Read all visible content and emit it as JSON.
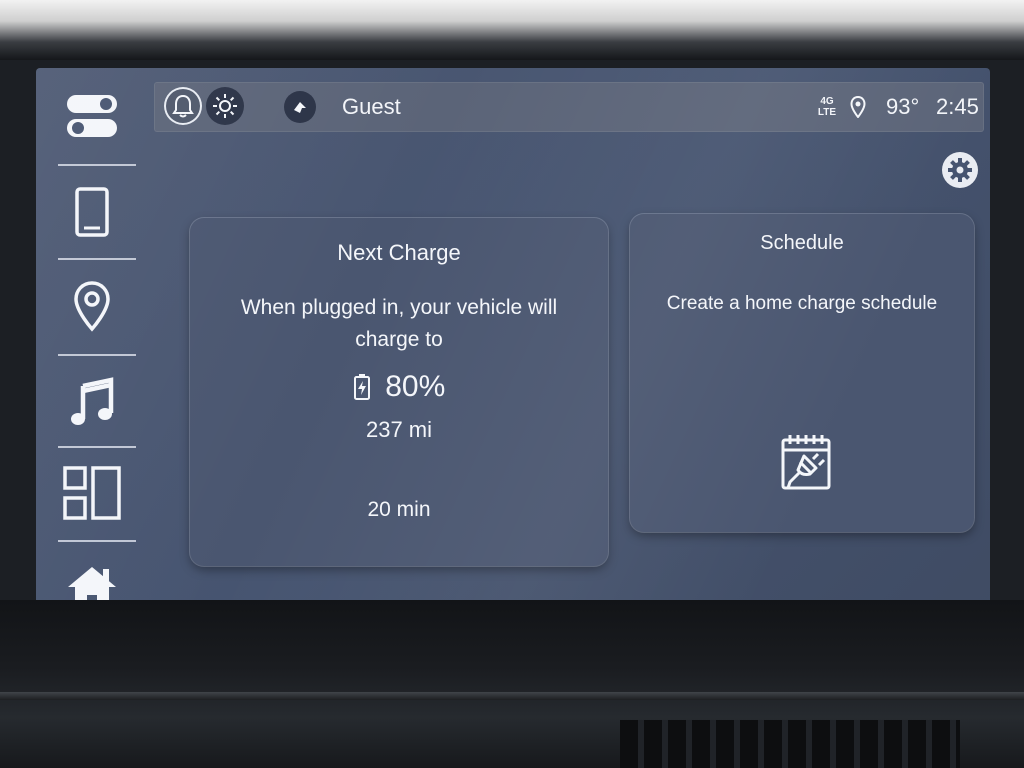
{
  "status_bar": {
    "profile_name": "Guest",
    "network": "4G LTE",
    "temperature": "93°",
    "time": "2:45"
  },
  "sidebar": {
    "items": [
      {
        "icon": "toggle-switches-icon"
      },
      {
        "icon": "phone-icon"
      },
      {
        "icon": "map-pin-icon"
      },
      {
        "icon": "music-note-icon"
      },
      {
        "icon": "apps-grid-icon"
      },
      {
        "icon": "home-icon"
      }
    ]
  },
  "next_charge": {
    "title": "Next Charge",
    "description": "When plugged in, your vehicle will charge to",
    "percent": "80%",
    "range": "237 mi",
    "duration": "20 min"
  },
  "schedule": {
    "title": "Schedule",
    "description": "Create a home charge schedule",
    "icon": "calendar-plug-icon"
  },
  "colors": {
    "screen_bg": "#465470",
    "card_bg": "#4a5670",
    "status_bar_bg": "#5b6478",
    "text": "#f4f6fa"
  }
}
